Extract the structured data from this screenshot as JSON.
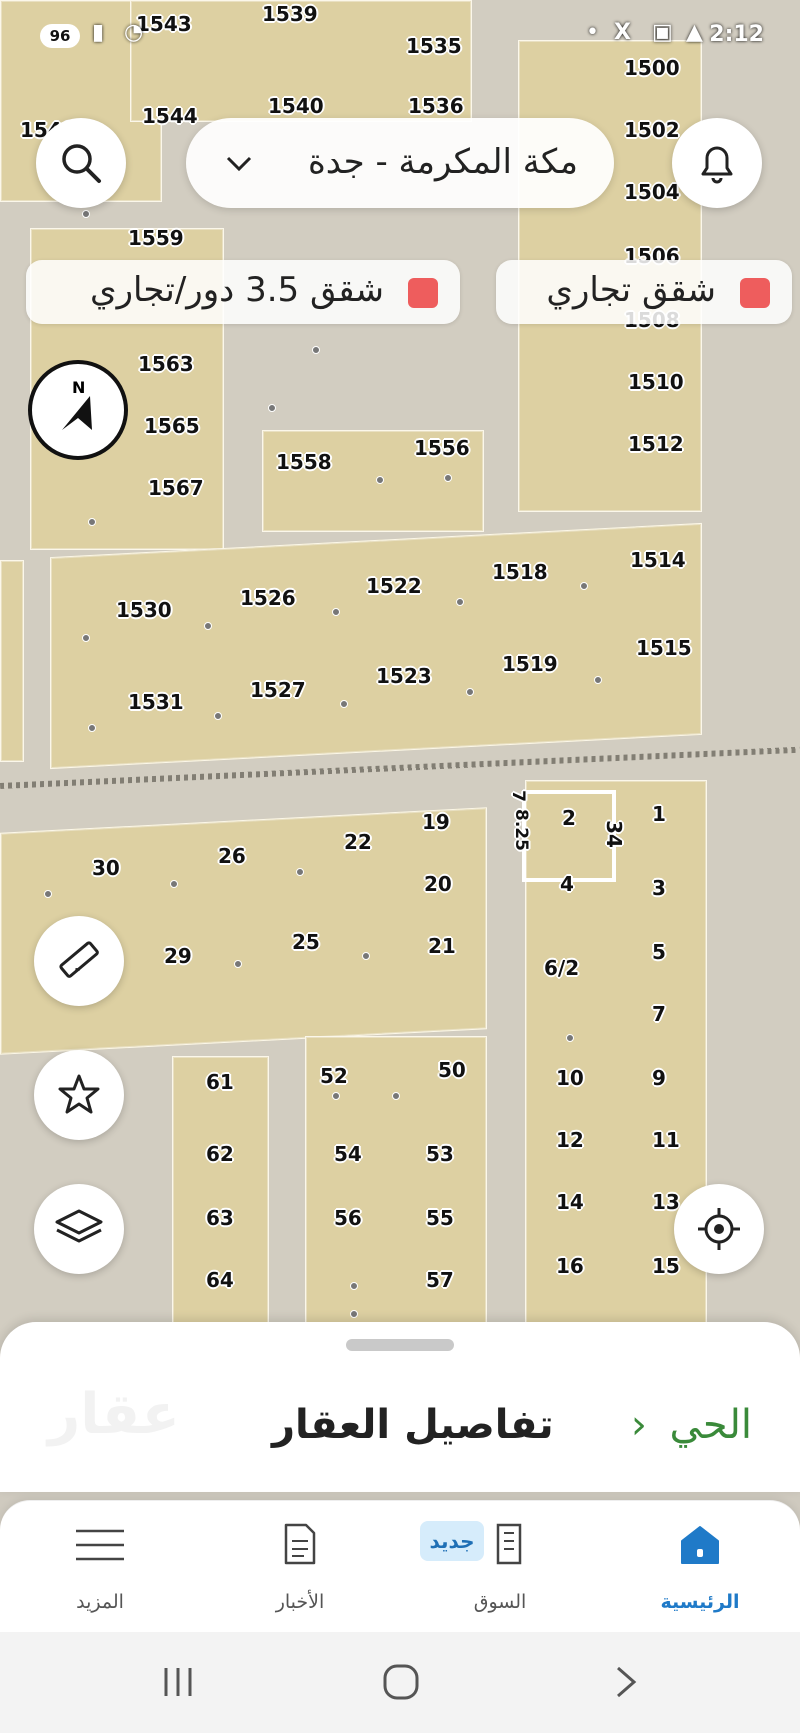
{
  "status_bar": {
    "battery": "96",
    "time": "2:12"
  },
  "header": {
    "location": "مكة المكرمة - جدة",
    "location_icon": "chevron-down-icon",
    "search_icon": "search-icon",
    "notification_icon": "bell-icon"
  },
  "chips": [
    {
      "label": "شقق تجاري",
      "color": "#ee5d5d"
    },
    {
      "label": "شقق 3.5 دور/تجاري",
      "color": "#ee5d5d"
    }
  ],
  "compass": {
    "letter": "N"
  },
  "map": {
    "plots": [
      "1543",
      "1539",
      "1535",
      "1500",
      "1548",
      "1544",
      "1540",
      "1536",
      "1502",
      "1504",
      "1559",
      "1506",
      "1508",
      "1563",
      "1510",
      "1565",
      "1512",
      "1567",
      "1558",
      "1556",
      "1514",
      "1518",
      "1522",
      "1526",
      "1530",
      "1515",
      "1519",
      "1523",
      "1527",
      "1531",
      "2",
      "1",
      "34",
      "19",
      "22",
      "26",
      "30",
      "20",
      "3",
      "29",
      "25",
      "21",
      "6/2",
      "5",
      "7",
      "50",
      "52",
      "61",
      "10",
      "9",
      "62",
      "54",
      "53",
      "12",
      "11",
      "63",
      "56",
      "55",
      "14",
      "13",
      "64",
      "57",
      "16",
      "15",
      "4",
      "8.25",
      "7"
    ]
  },
  "sheet": {
    "title": "تفاصيل العقار",
    "district_link": "الحي",
    "watermark": "عقار"
  },
  "bottom_nav": {
    "items": [
      {
        "label": "الرئيسية",
        "icon": "home-icon"
      },
      {
        "label": "السوق",
        "icon": "building-icon",
        "badge": "جديد"
      },
      {
        "label": "الأخبار",
        "icon": "news-icon"
      },
      {
        "label": "المزيد",
        "icon": "menu-icon"
      }
    ]
  }
}
